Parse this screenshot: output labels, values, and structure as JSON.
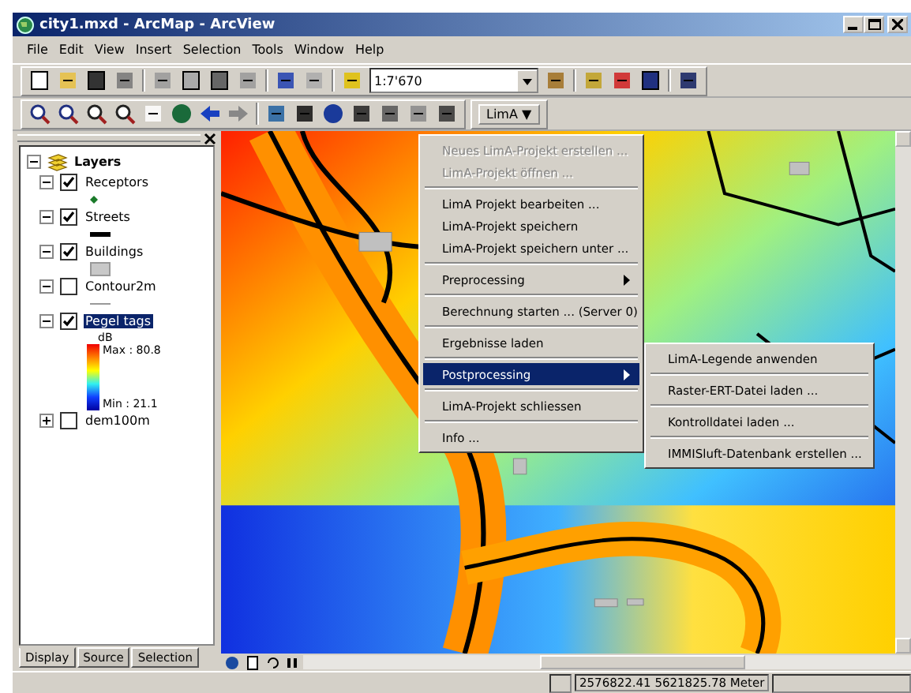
{
  "window": {
    "title": "city1.mxd - ArcMap - ArcView"
  },
  "menubar": [
    "File",
    "Edit",
    "View",
    "Insert",
    "Selection",
    "Tools",
    "Window",
    "Help"
  ],
  "scale": {
    "value": "1:7'670"
  },
  "lima_button": {
    "label": "LimA ▼"
  },
  "toc": {
    "root": "Layers",
    "layers": [
      {
        "name": "Receptors",
        "checked": true,
        "expanded": true,
        "selected": false,
        "kind": "point"
      },
      {
        "name": "Streets",
        "checked": true,
        "expanded": true,
        "selected": false,
        "kind": "line"
      },
      {
        "name": "Buildings",
        "checked": true,
        "expanded": true,
        "selected": false,
        "kind": "fill"
      },
      {
        "name": "Contour2m",
        "checked": false,
        "expanded": true,
        "selected": false,
        "kind": "thin"
      },
      {
        "name": "Pegel tags",
        "checked": true,
        "expanded": true,
        "selected": true,
        "kind": "ramp",
        "unit": "dB",
        "max": "Max : 80.8",
        "min": "Min : 21.1"
      },
      {
        "name": "dem100m",
        "checked": false,
        "expanded": false,
        "selected": false
      }
    ],
    "tabs": [
      {
        "label": "Display",
        "selected": true
      },
      {
        "label": "Source",
        "selected": false
      },
      {
        "label": "Selection",
        "selected": false
      }
    ]
  },
  "menu": [
    {
      "kind": "item",
      "label": "Neues LimA-Projekt erstellen ...",
      "disabled": true,
      "selected": false,
      "submenu": false
    },
    {
      "kind": "item",
      "label": "LimA-Projekt öffnen ...",
      "disabled": true,
      "selected": false,
      "submenu": false
    },
    {
      "kind": "separator"
    },
    {
      "kind": "item",
      "label": "LimA Projekt bearbeiten ...",
      "disabled": false,
      "selected": false,
      "submenu": false
    },
    {
      "kind": "item",
      "label": "LimA-Projekt speichern",
      "disabled": false,
      "selected": false,
      "submenu": false
    },
    {
      "kind": "item",
      "label": "LimA-Projekt speichern unter ...",
      "disabled": false,
      "selected": false,
      "submenu": false
    },
    {
      "kind": "separator"
    },
    {
      "kind": "item",
      "label": "Preprocessing",
      "disabled": false,
      "selected": false,
      "submenu": true
    },
    {
      "kind": "separator"
    },
    {
      "kind": "item",
      "label": "Berechnung starten ... (Server 0)",
      "disabled": false,
      "selected": false,
      "submenu": false
    },
    {
      "kind": "separator"
    },
    {
      "kind": "item",
      "label": "Ergebnisse laden",
      "disabled": false,
      "selected": false,
      "submenu": false
    },
    {
      "kind": "separator"
    },
    {
      "kind": "item",
      "label": "Postprocessing",
      "disabled": false,
      "selected": true,
      "submenu": true
    },
    {
      "kind": "separator"
    },
    {
      "kind": "item",
      "label": "LimA-Projekt schliessen",
      "disabled": false,
      "selected": false,
      "submenu": false
    },
    {
      "kind": "separator"
    },
    {
      "kind": "item",
      "label": "Info ...",
      "disabled": false,
      "selected": false,
      "submenu": false
    }
  ],
  "submenu": [
    {
      "kind": "item",
      "label": "LimA-Legende anwenden"
    },
    {
      "kind": "separator"
    },
    {
      "kind": "item",
      "label": "Raster-ERT-Datei laden ..."
    },
    {
      "kind": "separator"
    },
    {
      "kind": "item",
      "label": "Kontrolldatei laden ..."
    },
    {
      "kind": "separator"
    },
    {
      "kind": "item",
      "label": "IMMISluft-Datenbank erstellen ..."
    }
  ],
  "status_bar": {
    "coordinates": "2576822.41  5621825.78 Meter"
  }
}
